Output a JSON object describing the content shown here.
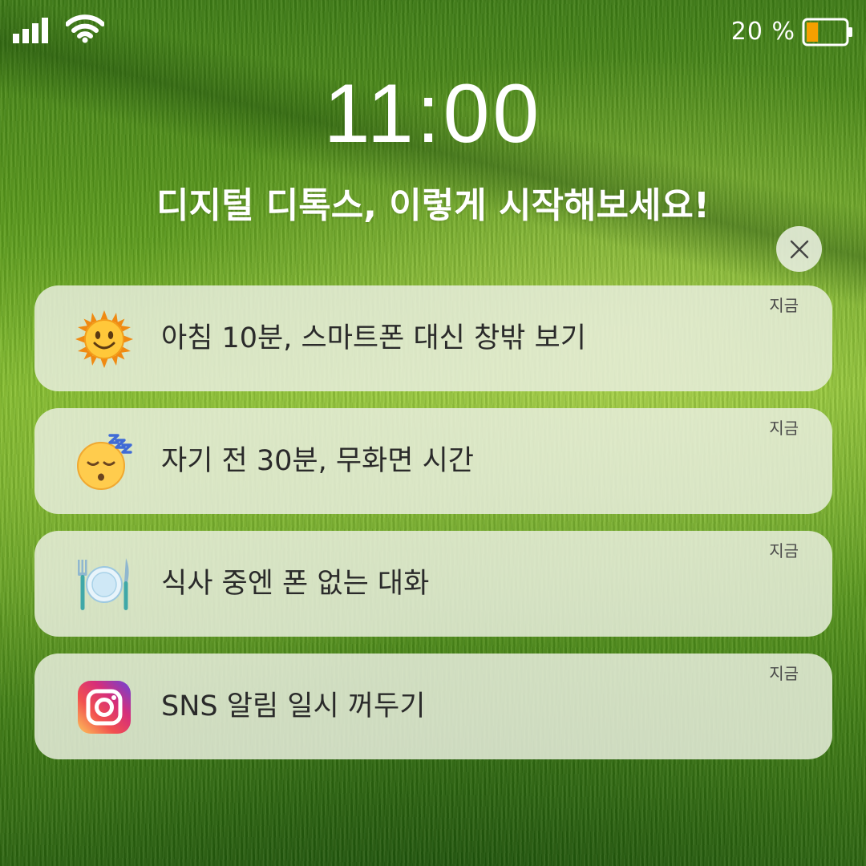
{
  "status_bar": {
    "signal_icon": "cellular-signal-icon",
    "wifi_icon": "wifi-icon",
    "battery_percent": "20 %",
    "battery_level": 0.2,
    "battery_fill_color": "#f5a000"
  },
  "lock_screen": {
    "time": "11:00",
    "headline": "디지털 디톡스, 이렇게 시작해보세요!"
  },
  "close_button": {
    "icon": "close-icon"
  },
  "notifications": [
    {
      "icon": "sun-face-icon",
      "text": "아침 10분, 스마트폰 대신 창밖 보기",
      "time": "지금"
    },
    {
      "icon": "sleeping-face-icon",
      "text": "자기 전 30분, 무화면 시간",
      "time": "지금"
    },
    {
      "icon": "plate-fork-knife-icon",
      "text": "식사 중엔 폰 없는 대화",
      "time": "지금"
    },
    {
      "icon": "instagram-icon",
      "text": "SNS 알림 일시 꺼두기",
      "time": "지금"
    }
  ]
}
